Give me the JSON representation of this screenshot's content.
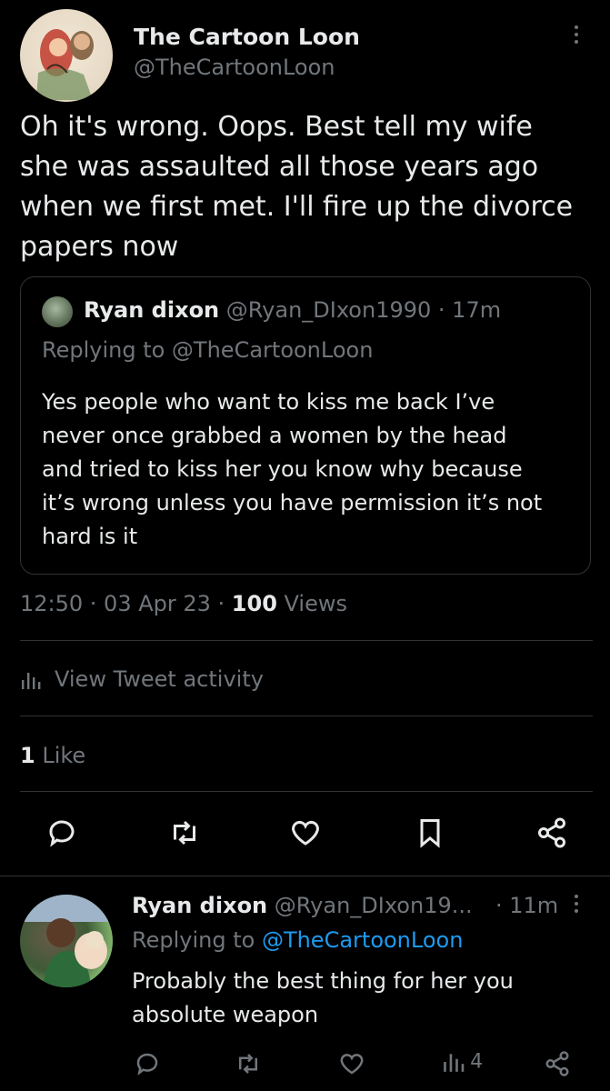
{
  "tweet": {
    "author_name": "The Cartoon Loon",
    "author_handle": "@TheCartoonLoon",
    "text_lines": [
      "Oh it's wrong. Oops. Best tell my wife",
      "she was assaulted all those years ago",
      "when we first met. I'll fire up the divorce",
      "papers now"
    ],
    "timestamp": "12:50 · 03 Apr 23 · ",
    "views_count": "100",
    "views_label": " Views",
    "activity_label": "View Tweet activity",
    "likes_count": "1",
    "likes_label": " Like"
  },
  "quoted": {
    "author_name": "Ryan dixon",
    "author_handle": "@Ryan_DIxon1990",
    "time": " · 17m",
    "replying_to": "Replying to @TheCartoonLoon",
    "text_lines": [
      "Yes people who want to kiss me back I’ve",
      "never once grabbed a women by the head",
      "and tried to kiss her you know why because",
      "it’s wrong unless you have permission it’s not",
      "hard is it"
    ]
  },
  "reply": {
    "author_name": "Ryan dixon",
    "author_handle": "@Ryan_DIxon19...",
    "time": "· 11m",
    "replying_prefix": "Replying to ",
    "replying_handle": "@TheCartoonLoon",
    "text_lines": [
      "Probably the best thing for her you",
      "absolute weapon"
    ],
    "views_count": "4"
  },
  "icons": {
    "reply": "reply-icon",
    "retweet": "retweet-icon",
    "like": "heart-icon",
    "bookmark": "bookmark-icon",
    "share": "share-icon",
    "analytics": "analytics-icon",
    "more": "more-icon"
  }
}
